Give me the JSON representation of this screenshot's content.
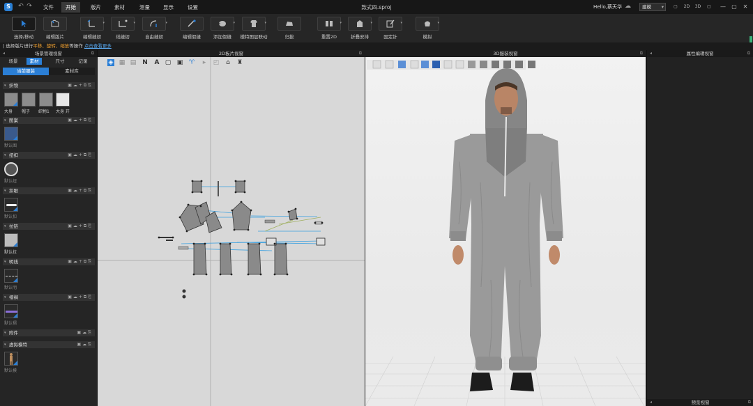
{
  "titlebar": {
    "logo": "S",
    "menu": [
      "文件",
      "开始",
      "版片",
      "素材",
      "测量",
      "显示",
      "设置"
    ],
    "active_menu": "开始",
    "document_title": "款式四.sproj",
    "greeting": "Hello,蔡天华",
    "mode_select": "建模",
    "view_buttons": [
      "▢",
      "2D",
      "3D",
      "▢"
    ],
    "window_buttons": [
      "—",
      "▢",
      "✕"
    ]
  },
  "toolbar": {
    "tools": [
      {
        "label": "选择/移动",
        "icon": "select-cursor-icon"
      },
      {
        "label": "编辑版片",
        "icon": "edit-pattern-icon"
      },
      {
        "label": "编辑缝纫",
        "icon": "edit-sewing-icon"
      },
      {
        "label": "线缝纫",
        "icon": "segment-sewing-icon"
      },
      {
        "label": "自由缝纫",
        "icon": "free-sewing-icon"
      },
      {
        "label": "编辑假缝",
        "icon": "edit-tack-icon"
      },
      {
        "label": "添加假缝",
        "icon": "add-tack-icon"
      },
      {
        "label": "模特图层联动",
        "icon": "avatar-layer-icon"
      },
      {
        "label": "归拔",
        "icon": "shrink-icon"
      },
      {
        "label": "重置2D",
        "icon": "reset-2d-icon"
      },
      {
        "label": "折叠安排",
        "icon": "fold-arrange-icon"
      },
      {
        "label": "固定针",
        "icon": "pin-icon"
      },
      {
        "label": "模拟",
        "icon": "simulate-icon"
      }
    ]
  },
  "hint": {
    "prefix": "| 选择版片进行",
    "actions": "平移、旋转、缩放",
    "suffix": "等操作",
    "link": "点击查看更多"
  },
  "left_panel": {
    "title": "场景管理视窗",
    "tabs": [
      "场景",
      "素材",
      "尺寸",
      "记录"
    ],
    "active_tab": "素材",
    "subtabs": [
      "当前服装",
      "素材库"
    ],
    "active_subtab": "当前服装",
    "sections": [
      {
        "name": "织物",
        "items": [
          "大身",
          "帽子",
          "织物1",
          "大身 开"
        ]
      },
      {
        "name": "图案",
        "items": [
          "默认图"
        ]
      },
      {
        "name": "纽扣",
        "items": [
          "默认纽"
        ]
      },
      {
        "name": "扣眼",
        "items": [
          "默认扣"
        ]
      },
      {
        "name": "拉链",
        "items": [
          "默认拉"
        ]
      },
      {
        "name": "明线",
        "items": [
          "默认明"
        ]
      },
      {
        "name": "褶裥",
        "items": [
          "默认褶"
        ]
      },
      {
        "name": "附件",
        "items": []
      },
      {
        "name": "虚拟模特",
        "items": [
          "默认模"
        ]
      }
    ]
  },
  "view2d": {
    "title": "2D板片视窗"
  },
  "view3d": {
    "title": "3D服装视窗"
  },
  "right_panel": {
    "title": "属性编辑视窗",
    "bottom_title": "预览视窗"
  },
  "colors": {
    "accent": "#2b7fd6",
    "warning": "#f0a030",
    "pattern_fill": "#8a8a8a",
    "sewing_line": "#3aa0e0",
    "garment": "#9a9a9a"
  }
}
